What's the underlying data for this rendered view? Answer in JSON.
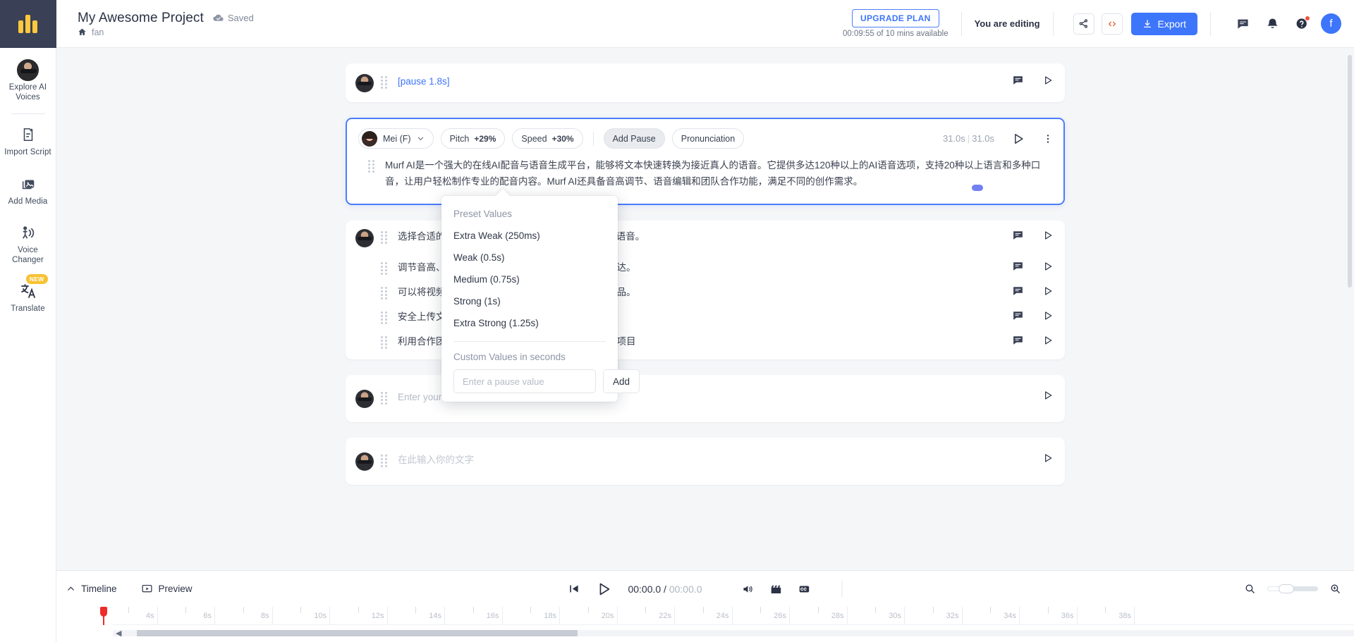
{
  "app": {
    "logo": "murf-logo"
  },
  "rail": {
    "items": [
      {
        "label": "Explore AI Voices",
        "icon": "avatar-icon",
        "badge": ""
      },
      {
        "label": "Import Script",
        "icon": "document-plus-icon",
        "badge": ""
      },
      {
        "label": "Add Media",
        "icon": "media-library-icon",
        "badge": ""
      },
      {
        "label": "Voice Changer",
        "icon": "voice-changer-icon",
        "badge": ""
      },
      {
        "label": "Translate",
        "icon": "translate-icon",
        "badge": "NEW"
      }
    ]
  },
  "header": {
    "project_title": "My Awesome Project",
    "saved_label": "Saved",
    "saved_icon": "cloud-check-icon",
    "breadcrumb_icon": "home-icon",
    "breadcrumb": "fan",
    "upgrade_label": "UPGRADE PLAN",
    "plan_sub": "00:09:55 of 10 mins available",
    "editing_label": "You are editing",
    "share_icon": "share-icon",
    "embed_icon": "code-icon",
    "export_label": "Export",
    "export_icon": "download-icon",
    "chat_icon": "chat-icon",
    "bell_icon": "bell-icon",
    "help_icon": "help-icon",
    "avatar_initial": "f",
    "accent": "#3d75fb"
  },
  "blocks": [
    {
      "type": "pause",
      "text": "[pause 1.8s]",
      "actions": [
        "comment-icon",
        "play-icon"
      ]
    },
    {
      "type": "selected",
      "voice": "Mei (F)",
      "pitch_label": "Pitch",
      "pitch_value": "+29%",
      "speed_label": "Speed",
      "speed_value": "+30%",
      "add_pause_label": "Add Pause",
      "pronunciation_label": "Pronunciation",
      "duration_current": "31.0s",
      "duration_total": "31.0s",
      "play_icon": "play-icon",
      "more_icon": "more-vertical-icon",
      "text": "Murf AI是一个强大的在线AI配音与语音生成平台，能够将文本快速转换为接近真人的语音。它提供多达120种以上的AI语音选项，支持20种以上语言和多种口音，让用户轻松制作专业的配音内容。Murf AI还具备音高调节、语音编辑和团队合作功能，满足不同的创作需求。"
    },
    {
      "type": "list",
      "rows": [
        "选择合适的AI语音并输入文本，即可生成自然流畅的语音。",
        "调节音高、重音和暂停，让配音效果更加贴近真人表达。",
        "可以将视频、音乐或图片与语音同步，制作完整的作品。",
        "安全上传文档，Murf会自动识别并转换为语音内容。",
        "利用合作团队功能，与团队成员一起编辑和生成语音项目"
      ],
      "actions": [
        "comment-icon",
        "play-icon"
      ]
    },
    {
      "type": "empty",
      "placeholder": "Enter your text here",
      "actions": [
        "play-icon"
      ]
    },
    {
      "type": "empty-cn",
      "placeholder": "在此输入你的文字",
      "actions": [
        "play-icon"
      ]
    }
  ],
  "dropdown": {
    "title": "Add Pause",
    "preset_header": "Preset Values",
    "presets": [
      "Extra Weak (250ms)",
      "Weak (0.5s)",
      "Medium (0.75s)",
      "Strong (1s)",
      "Extra Strong (1.25s)"
    ],
    "custom_header": "Custom Values in seconds",
    "custom_placeholder": "Enter a pause value",
    "custom_value": "",
    "add_label": "Add"
  },
  "bottom_bar": {
    "timeline_label": "Timeline",
    "timeline_icon": "chevron-up-icon",
    "preview_label": "Preview",
    "preview_icon": "preview-screen-icon",
    "skip_start_icon": "skip-to-start-icon",
    "play_icon": "play-icon",
    "time_current": "00:00.0",
    "time_separator": "/",
    "time_total": "00:00.0",
    "volume_icon": "volume-icon",
    "clapper_icon": "clapperboard-icon",
    "captions_icon": "captions-icon",
    "zoom_out_icon": "zoom-out-icon",
    "zoom_in_icon": "zoom-in-icon",
    "zoom_value": 38
  },
  "timeline": {
    "ticks": [
      "4s",
      "6s",
      "8s",
      "10s",
      "12s",
      "14s",
      "16s",
      "18s",
      "20s",
      "22s",
      "24s",
      "26s",
      "28s",
      "30s",
      "32s",
      "34s",
      "36s",
      "38s"
    ],
    "playhead_position": "0s"
  }
}
